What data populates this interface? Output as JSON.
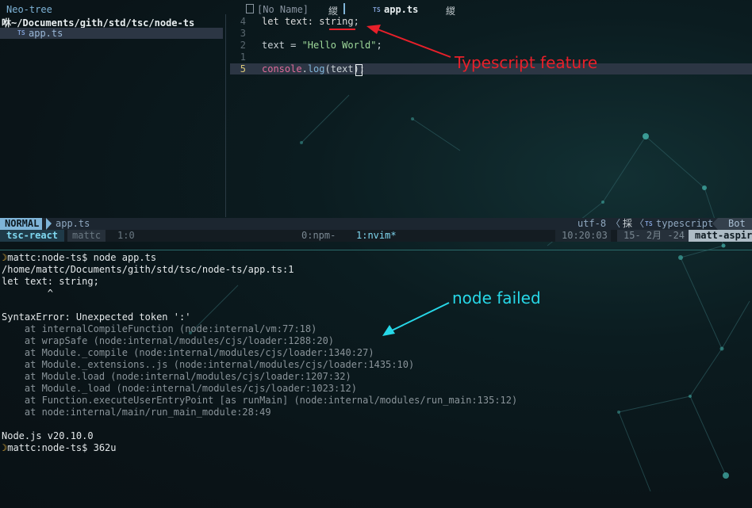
{
  "neotree": {
    "title": "Neo-tree",
    "path": "~/Documents/gith/std/tsc/node-ts",
    "folder_glyph": "咻",
    "file_icon": "TS",
    "file": "app.ts"
  },
  "tabs": {
    "inactive_label": "[No Name]",
    "inactive_close": "緵",
    "active_icon": "TS",
    "active_label": "app.ts",
    "active_close": "緵"
  },
  "editor": {
    "lines": [
      {
        "number": "4",
        "tokens": [
          "let text: ",
          "string",
          ";"
        ]
      },
      {
        "number": "3",
        "tokens": []
      },
      {
        "number": "2",
        "tokens": [
          "text = ",
          "\"Hello World\"",
          ";"
        ]
      },
      {
        "number": "1",
        "tokens": []
      },
      {
        "number": "5",
        "tokens": [
          "console",
          ".",
          "log",
          "(text)",
          ";"
        ]
      }
    ]
  },
  "annotations": {
    "typescript": "Typescript feature",
    "node": "node failed",
    "colors": {
      "typescript": "#e8202a",
      "node": "#27d8e8"
    }
  },
  "statusline": {
    "mode": "NORMAL",
    "file": "app.ts",
    "encoding": "utf-8",
    "sep": "〈",
    "os_icon": "採",
    "filetype_icon": "TS",
    "filetype": "typescript",
    "position": "Bot"
  },
  "tmux": {
    "session": "tsc-react",
    "user": "mattc",
    "pos": "1:0",
    "window0": "0:npm-",
    "window1": "1:nvim*",
    "time": "10:20:03",
    "date": "15- 2月 -24",
    "host": "matt-aspire"
  },
  "terminal": {
    "prompt_icon": "moon-icon",
    "lines": [
      {
        "moon": true,
        "text": "mattc:node-ts$ node app.ts",
        "dim": false
      },
      {
        "moon": false,
        "text": "/home/mattc/Documents/gith/std/tsc/node-ts/app.ts:1",
        "dim": false
      },
      {
        "moon": false,
        "text": "let text: string;",
        "dim": false
      },
      {
        "moon": false,
        "text": "        ^",
        "dim": false
      },
      {
        "moon": false,
        "text": "",
        "dim": false
      },
      {
        "moon": false,
        "text": "SyntaxError: Unexpected token ':'",
        "dim": false
      },
      {
        "moon": false,
        "text": "    at internalCompileFunction (node:internal/vm:77:18)",
        "dim": true
      },
      {
        "moon": false,
        "text": "    at wrapSafe (node:internal/modules/cjs/loader:1288:20)",
        "dim": true
      },
      {
        "moon": false,
        "text": "    at Module._compile (node:internal/modules/cjs/loader:1340:27)",
        "dim": true
      },
      {
        "moon": false,
        "text": "    at Module._extensions..js (node:internal/modules/cjs/loader:1435:10)",
        "dim": true
      },
      {
        "moon": false,
        "text": "    at Module.load (node:internal/modules/cjs/loader:1207:32)",
        "dim": true
      },
      {
        "moon": false,
        "text": "    at Module._load (node:internal/modules/cjs/loader:1023:12)",
        "dim": true
      },
      {
        "moon": false,
        "text": "    at Function.executeUserEntryPoint [as runMain] (node:internal/modules/run_main:135:12)",
        "dim": true
      },
      {
        "moon": false,
        "text": "    at node:internal/main/run_main_module:28:49",
        "dim": true
      },
      {
        "moon": false,
        "text": "",
        "dim": false
      },
      {
        "moon": false,
        "text": "Node.js v20.10.0",
        "dim": false
      },
      {
        "moon": true,
        "text": "mattc:node-ts$ 362u",
        "dim": false
      }
    ]
  }
}
